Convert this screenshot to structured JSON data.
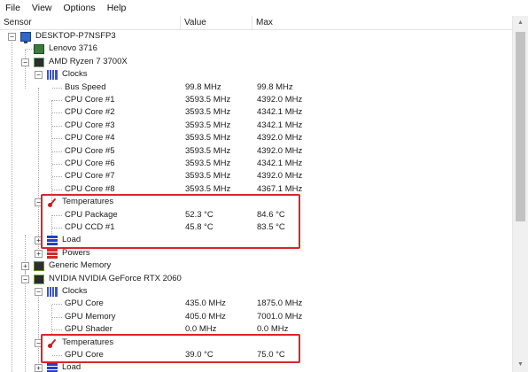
{
  "menu": {
    "file": "File",
    "view": "View",
    "options": "Options",
    "help": "Help"
  },
  "columns": {
    "sensor": "Sensor",
    "value": "Value",
    "max": "Max"
  },
  "tree": {
    "computer": "DESKTOP-P7NSFP3",
    "board": "Lenovo 3716",
    "cpu": {
      "name": "AMD Ryzen 7 3700X",
      "clocks_label": "Clocks",
      "clocks": [
        {
          "label": "Bus Speed",
          "value": "99.8 MHz",
          "max": "99.8 MHz"
        },
        {
          "label": "CPU Core #1",
          "value": "3593.5 MHz",
          "max": "4392.0 MHz"
        },
        {
          "label": "CPU Core #2",
          "value": "3593.5 MHz",
          "max": "4342.1 MHz"
        },
        {
          "label": "CPU Core #3",
          "value": "3593.5 MHz",
          "max": "4342.1 MHz"
        },
        {
          "label": "CPU Core #4",
          "value": "3593.5 MHz",
          "max": "4392.0 MHz"
        },
        {
          "label": "CPU Core #5",
          "value": "3593.5 MHz",
          "max": "4392.0 MHz"
        },
        {
          "label": "CPU Core #6",
          "value": "3593.5 MHz",
          "max": "4342.1 MHz"
        },
        {
          "label": "CPU Core #7",
          "value": "3593.5 MHz",
          "max": "4392.0 MHz"
        },
        {
          "label": "CPU Core #8",
          "value": "3593.5 MHz",
          "max": "4367.1 MHz"
        }
      ],
      "temps_label": "Temperatures",
      "temps": [
        {
          "label": "CPU Package",
          "value": "52.3 °C",
          "max": "84.6 °C"
        },
        {
          "label": "CPU CCD #1",
          "value": "45.8 °C",
          "max": "83.5 °C"
        }
      ],
      "load_label": "Load",
      "powers_label": "Powers"
    },
    "memory": "Generic Memory",
    "gpu": {
      "name": "NVIDIA NVIDIA GeForce RTX 2060",
      "clocks_label": "Clocks",
      "clocks": [
        {
          "label": "GPU Core",
          "value": "435.0 MHz",
          "max": "1875.0 MHz"
        },
        {
          "label": "GPU Memory",
          "value": "405.0 MHz",
          "max": "7001.0 MHz"
        },
        {
          "label": "GPU Shader",
          "value": "0.0 MHz",
          "max": "0.0 MHz"
        }
      ],
      "temps_label": "Temperatures",
      "temps": [
        {
          "label": "GPU Core",
          "value": "39.0 °C",
          "max": "75.0 °C"
        }
      ],
      "load_label": "Load"
    }
  },
  "expanders": {
    "collapse": "−",
    "expand": "+"
  },
  "highlight_color": "#d7262c",
  "icons": [
    "computer-icon",
    "motherboard-icon",
    "cpu-chip-icon",
    "clock-icon",
    "thermometer-icon",
    "load-bars-icon",
    "power-icon",
    "memory-icon",
    "gpu-card-icon"
  ]
}
